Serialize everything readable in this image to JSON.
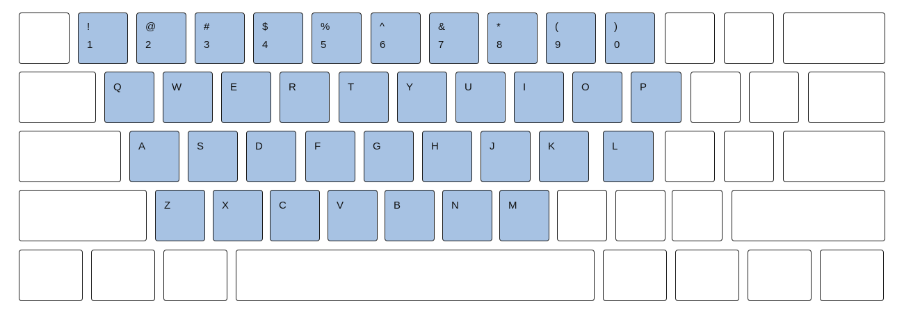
{
  "colors": {
    "highlight": "#a7c2e3",
    "plain": "#ffffff",
    "border": "#1a1a1a"
  },
  "rows": [
    {
      "keys": [
        {
          "hl": false
        },
        {
          "top": "!",
          "bottom": "1",
          "hl": true
        },
        {
          "top": "@",
          "bottom": "2",
          "hl": true
        },
        {
          "top": "#",
          "bottom": "3",
          "hl": true
        },
        {
          "top": "$",
          "bottom": "4",
          "hl": true
        },
        {
          "top": "%",
          "bottom": "5",
          "hl": true
        },
        {
          "top": "^",
          "bottom": "6",
          "hl": true
        },
        {
          "top": "&",
          "bottom": "7",
          "hl": true
        },
        {
          "top": "*",
          "bottom": "8",
          "hl": true
        },
        {
          "top": "(",
          "bottom": "9",
          "hl": true
        },
        {
          "top": ")",
          "bottom": "0",
          "hl": true
        },
        {
          "hl": false
        },
        {
          "hl": false
        },
        {
          "hl": false
        }
      ]
    },
    {
      "keys": [
        {
          "hl": false
        },
        {
          "label": "Q",
          "hl": true
        },
        {
          "label": "W",
          "hl": true
        },
        {
          "label": "E",
          "hl": true
        },
        {
          "label": "R",
          "hl": true
        },
        {
          "label": "T",
          "hl": true
        },
        {
          "label": "Y",
          "hl": true
        },
        {
          "label": "U",
          "hl": true
        },
        {
          "label": "I",
          "hl": true
        },
        {
          "label": "O",
          "hl": true
        },
        {
          "label": "P",
          "hl": true
        },
        {
          "hl": false
        },
        {
          "hl": false
        },
        {
          "hl": false
        }
      ]
    },
    {
      "keys": [
        {
          "hl": false
        },
        {
          "label": "A",
          "hl": true
        },
        {
          "label": "S",
          "hl": true
        },
        {
          "label": "D",
          "hl": true
        },
        {
          "label": "F",
          "hl": true
        },
        {
          "label": "G",
          "hl": true
        },
        {
          "label": "H",
          "hl": true
        },
        {
          "label": "J",
          "hl": true
        },
        {
          "label": "K",
          "hl": true
        },
        {
          "label": "L",
          "hl": true
        },
        {
          "hl": false
        },
        {
          "hl": false
        },
        {
          "hl": false
        }
      ]
    },
    {
      "keys": [
        {
          "hl": false
        },
        {
          "label": "Z",
          "hl": true
        },
        {
          "label": "X",
          "hl": true
        },
        {
          "label": "C",
          "hl": true
        },
        {
          "label": "V",
          "hl": true
        },
        {
          "label": "B",
          "hl": true
        },
        {
          "label": "N",
          "hl": true
        },
        {
          "label": "M",
          "hl": true
        },
        {
          "hl": false
        },
        {
          "hl": false
        },
        {
          "hl": false
        },
        {
          "hl": false
        }
      ]
    },
    {
      "keys": [
        {
          "hl": false
        },
        {
          "hl": false
        },
        {
          "hl": false
        },
        {
          "hl": false
        },
        {
          "hl": false
        },
        {
          "hl": false
        },
        {
          "hl": false
        },
        {
          "hl": false
        }
      ]
    }
  ]
}
